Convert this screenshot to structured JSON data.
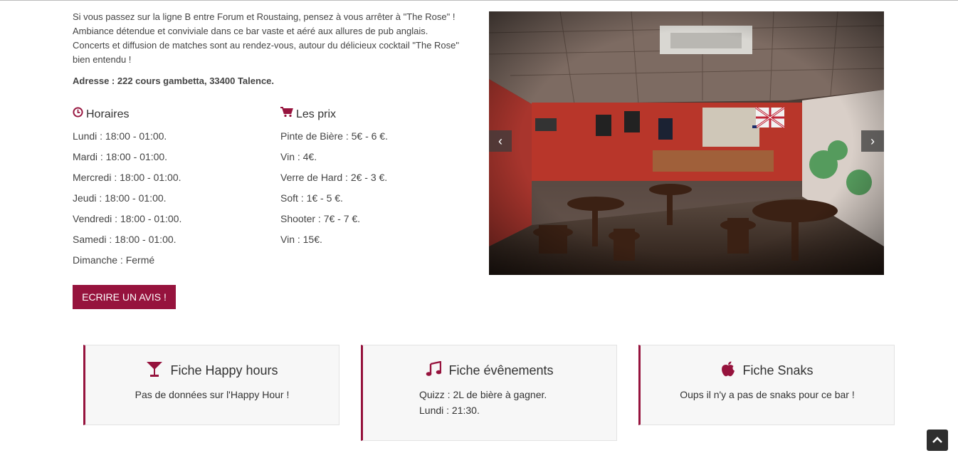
{
  "intro": {
    "line1": "Si vous passez sur la ligne B entre Forum et Roustaing, pensez à vous arrêter à \"The Rose\" !",
    "line2": "Ambiance détendue et conviviale dans ce bar vaste et aéré aux allures de pub anglais.",
    "line3": "Concerts et diffusion de matches sont au rendez-vous, autour du délicieux cocktail \"The Rose\"",
    "line4": "bien entendu !"
  },
  "address": "Adresse : 222 cours gambetta, 33400 Talence.",
  "hours": {
    "title": "Horaires",
    "icon": "clock-icon",
    "items": [
      "Lundi : 18:00 - 01:00.",
      "Mardi : 18:00 - 01:00.",
      "Mercredi : 18:00 - 01:00.",
      "Jeudi : 18:00 - 01:00.",
      "Vendredi : 18:00 - 01:00.",
      "Samedi : 18:00 - 01:00.",
      "Dimanche : Fermé"
    ]
  },
  "prices": {
    "title": "Les prix",
    "icon": "cart-icon",
    "items": [
      "Pinte de Bière : 5€ - 6 €.",
      "Vin : 4€.",
      "Verre de Hard : 2€ - 3 €.",
      "Soft : 1€ - 5 €.",
      "Shooter : 7€ - 7 €.",
      "Vin : 15€."
    ]
  },
  "review_button": "ECRIRE UN AVIS !",
  "carousel": {
    "prev_icon": "chevron-left-icon",
    "next_icon": "chevron-right-icon",
    "prev_glyph": "‹",
    "next_glyph": "›"
  },
  "cards": [
    {
      "title": "Fiche Happy hours",
      "icon": "cocktail-glass-icon",
      "lines": [
        "Pas de données sur l'Happy Hour !"
      ]
    },
    {
      "title": "Fiche évênements",
      "icon": "music-note-icon",
      "lines": [
        "Quizz : 2L de bière à gagner.",
        "Lundi : 21:30."
      ]
    },
    {
      "title": "Fiche Snaks",
      "icon": "apple-icon",
      "lines": [
        "Oups il n'y a pas de snaks pour ce bar !"
      ]
    }
  ],
  "scroll_top": {
    "icon": "chevron-up-icon"
  },
  "colors": {
    "accent": "#96133d",
    "card_bg": "#f7f7f7",
    "text": "#333333"
  }
}
